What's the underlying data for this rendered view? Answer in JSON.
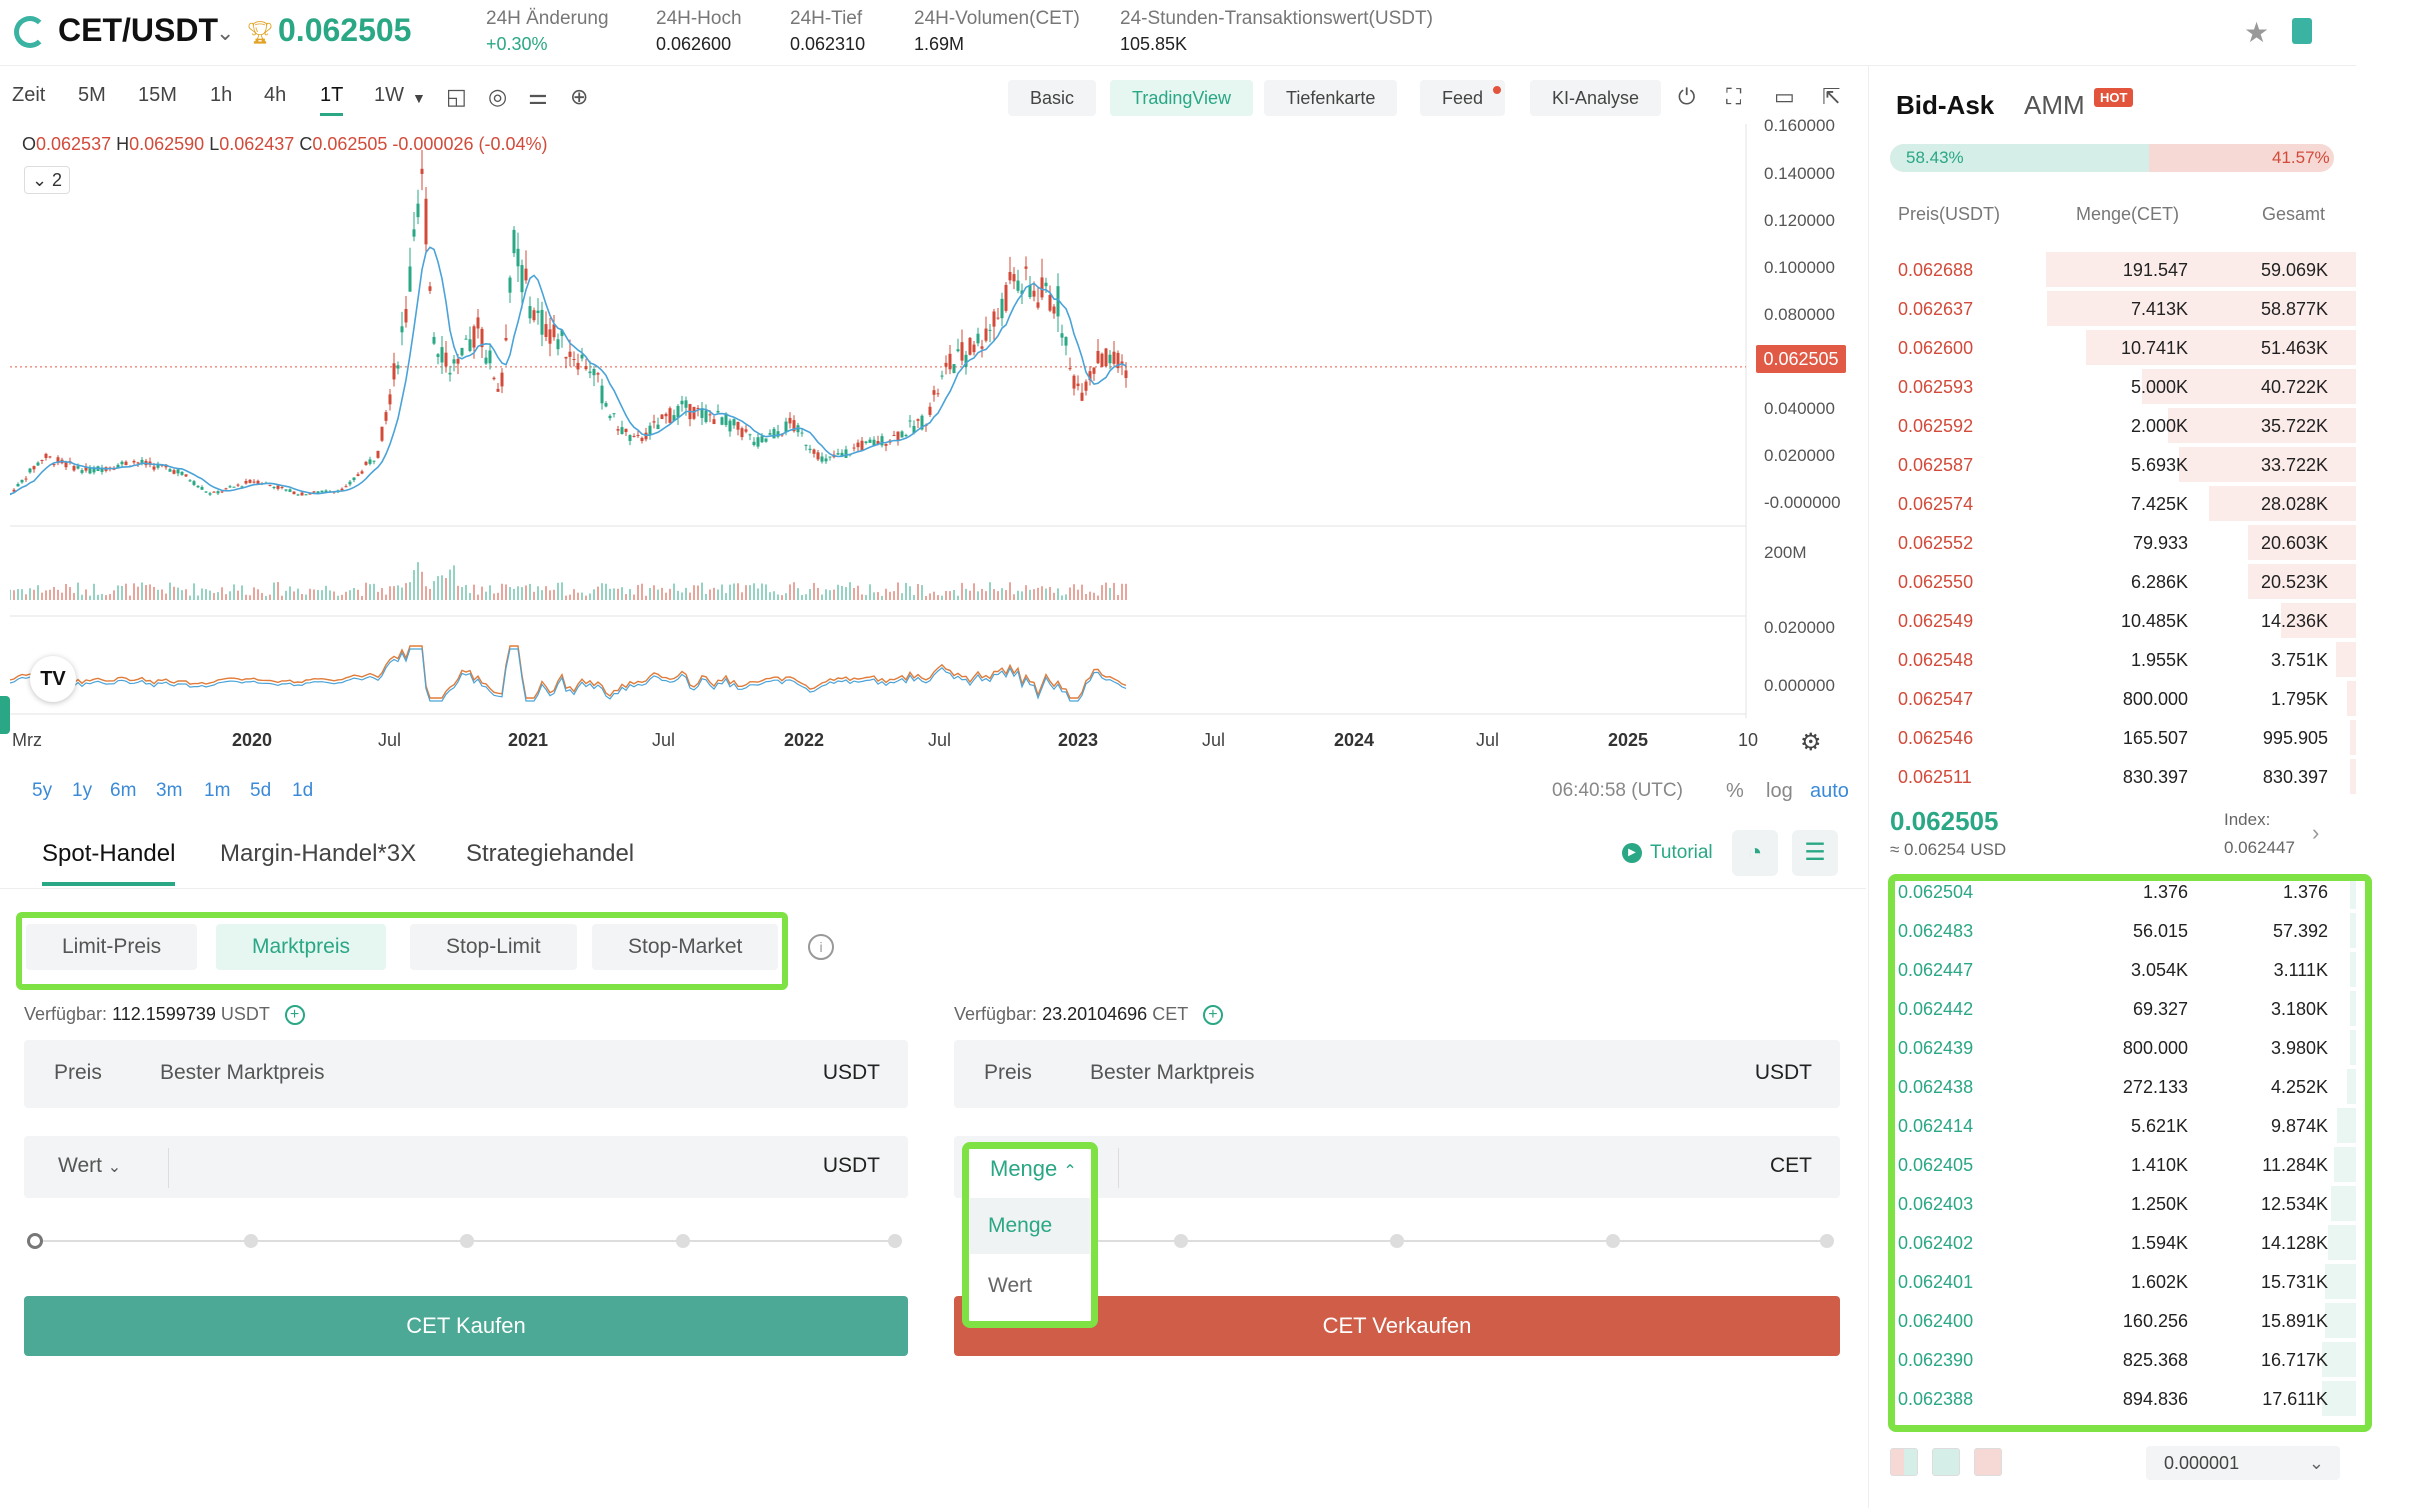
{
  "header": {
    "pair": "CET/USDT",
    "last_price": "0.062505",
    "stats": [
      {
        "label": "24H Änderung",
        "value": "+0.30%"
      },
      {
        "label": "24H-Hoch",
        "value": "0.062600"
      },
      {
        "label": "24H-Tief",
        "value": "0.062310"
      },
      {
        "label": "24H-Volumen(CET)",
        "value": "1.69M"
      },
      {
        "label": "24-Stunden-Transaktionswert(USDT)",
        "value": "105.85K"
      }
    ]
  },
  "chart_toolbar": {
    "intervals": [
      "Zeit",
      "5M",
      "15M",
      "1h",
      "4h",
      "1T",
      "1W"
    ],
    "active_interval": "1T",
    "views": [
      "Basic",
      "TradingView",
      "Tiefenkarte",
      "Feed",
      "KI-Analyse"
    ],
    "active_view": "TradingView"
  },
  "chart": {
    "ohlc": {
      "o": "0.062537",
      "h": "0.062590",
      "l": "0.062437",
      "c": "0.062505",
      "chg": "-0.000026 (-0.04%)"
    },
    "indicator_count": "2",
    "price_axis": [
      "0.160000",
      "0.140000",
      "0.120000",
      "0.100000",
      "0.080000",
      "0.062505",
      "0.040000",
      "0.020000",
      "-0.000000"
    ],
    "volume_axis": [
      "200M"
    ],
    "osc_axis": [
      "0.020000",
      "0.000000"
    ],
    "time_axis": [
      "Mrz",
      "2020",
      "Jul",
      "2021",
      "Jul",
      "2022",
      "Jul",
      "2023",
      "Jul",
      "2024",
      "Jul",
      "2025",
      "10"
    ],
    "ranges": [
      "5y",
      "1y",
      "6m",
      "3m",
      "1m",
      "5d",
      "1d"
    ],
    "clock": "06:40:58 (UTC)",
    "scale_options": [
      "%",
      "log",
      "auto"
    ],
    "active_scale": "auto",
    "current_price": "0.062505"
  },
  "trade": {
    "tabs": [
      "Spot-Handel",
      "Margin-Handel*3X",
      "Strategiehandel"
    ],
    "tutorial": "Tutorial",
    "order_types": [
      "Limit-Preis",
      "Marktpreis",
      "Stop-Limit",
      "Stop-Market"
    ],
    "active_order_type": "Marktpreis",
    "buy": {
      "available_label": "Verfügbar:",
      "available_value": "112.1599739",
      "available_unit": "USDT",
      "price_label": "Preis",
      "price_value": "Bester Marktpreis",
      "price_unit": "USDT",
      "mode": "Wert",
      "mode_unit": "USDT",
      "button": "CET Kaufen"
    },
    "sell": {
      "available_label": "Verfügbar:",
      "available_value": "23.20104696",
      "available_unit": "CET",
      "price_label": "Preis",
      "price_value": "Bester Marktpreis",
      "price_unit": "USDT",
      "mode": "Menge",
      "mode_unit": "CET",
      "button": "CET Verkaufen",
      "dropdown_options": [
        "Menge",
        "Wert"
      ]
    }
  },
  "orderbook": {
    "tabs": [
      "Bid-Ask",
      "AMM"
    ],
    "hot_badge": "HOT",
    "buy_ratio": "58.43%",
    "sell_ratio": "41.57%",
    "buy_ratio_fraction": 0.5843,
    "headers": [
      "Preis(USDT)",
      "Menge(CET)",
      "Gesamt"
    ],
    "asks": [
      {
        "price": "0.062688",
        "qty": "191.547",
        "total": "59.069K",
        "depth": 1.0
      },
      {
        "price": "0.062637",
        "qty": "7.413K",
        "total": "58.877K",
        "depth": 0.997
      },
      {
        "price": "0.062600",
        "qty": "10.741K",
        "total": "51.463K",
        "depth": 0.871
      },
      {
        "price": "0.062593",
        "qty": "5.000K",
        "total": "40.722K",
        "depth": 0.689
      },
      {
        "price": "0.062592",
        "qty": "2.000K",
        "total": "35.722K",
        "depth": 0.605
      },
      {
        "price": "0.062587",
        "qty": "5.693K",
        "total": "33.722K",
        "depth": 0.571
      },
      {
        "price": "0.062574",
        "qty": "7.425K",
        "total": "28.028K",
        "depth": 0.474
      },
      {
        "price": "0.062552",
        "qty": "79.933",
        "total": "20.603K",
        "depth": 0.349
      },
      {
        "price": "0.062550",
        "qty": "6.286K",
        "total": "20.523K",
        "depth": 0.347
      },
      {
        "price": "0.062549",
        "qty": "10.485K",
        "total": "14.236K",
        "depth": 0.241
      },
      {
        "price": "0.062548",
        "qty": "1.955K",
        "total": "3.751K",
        "depth": 0.064
      },
      {
        "price": "0.062547",
        "qty": "800.000",
        "total": "1.795K",
        "depth": 0.03
      },
      {
        "price": "0.062546",
        "qty": "165.507",
        "total": "995.905",
        "depth": 0.017
      },
      {
        "price": "0.062511",
        "qty": "830.397",
        "total": "830.397",
        "depth": 0.014
      }
    ],
    "mid_price": "0.062505",
    "mid_usd": "≈ 0.06254 USD",
    "index_label": "Index:",
    "index_value": "0.062447",
    "bids": [
      {
        "price": "0.062504",
        "qty": "1.376",
        "total": "1.376",
        "depth": 0.01
      },
      {
        "price": "0.062483",
        "qty": "56.015",
        "total": "57.392",
        "depth": 0.01
      },
      {
        "price": "0.062447",
        "qty": "3.054K",
        "total": "3.111K",
        "depth": 0.02
      },
      {
        "price": "0.062442",
        "qty": "69.327",
        "total": "3.180K",
        "depth": 0.02
      },
      {
        "price": "0.062439",
        "qty": "800.000",
        "total": "3.980K",
        "depth": 0.02
      },
      {
        "price": "0.062438",
        "qty": "272.133",
        "total": "4.252K",
        "depth": 0.03
      },
      {
        "price": "0.062414",
        "qty": "5.621K",
        "total": "9.874K",
        "depth": 0.06
      },
      {
        "price": "0.062405",
        "qty": "1.410K",
        "total": "11.284K",
        "depth": 0.07
      },
      {
        "price": "0.062403",
        "qty": "1.250K",
        "total": "12.534K",
        "depth": 0.08
      },
      {
        "price": "0.062402",
        "qty": "1.594K",
        "total": "14.128K",
        "depth": 0.09
      },
      {
        "price": "0.062401",
        "qty": "1.602K",
        "total": "15.731K",
        "depth": 0.1
      },
      {
        "price": "0.062400",
        "qty": "160.256",
        "total": "15.891K",
        "depth": 0.1
      },
      {
        "price": "0.062390",
        "qty": "825.368",
        "total": "16.717K",
        "depth": 0.11
      },
      {
        "price": "0.062388",
        "qty": "894.836",
        "total": "17.611K",
        "depth": 0.11
      }
    ],
    "precision": "0.000001"
  },
  "colors": {
    "accent": "#2aa784",
    "sell": "#d24b3a",
    "highlight": "#7ee245"
  }
}
